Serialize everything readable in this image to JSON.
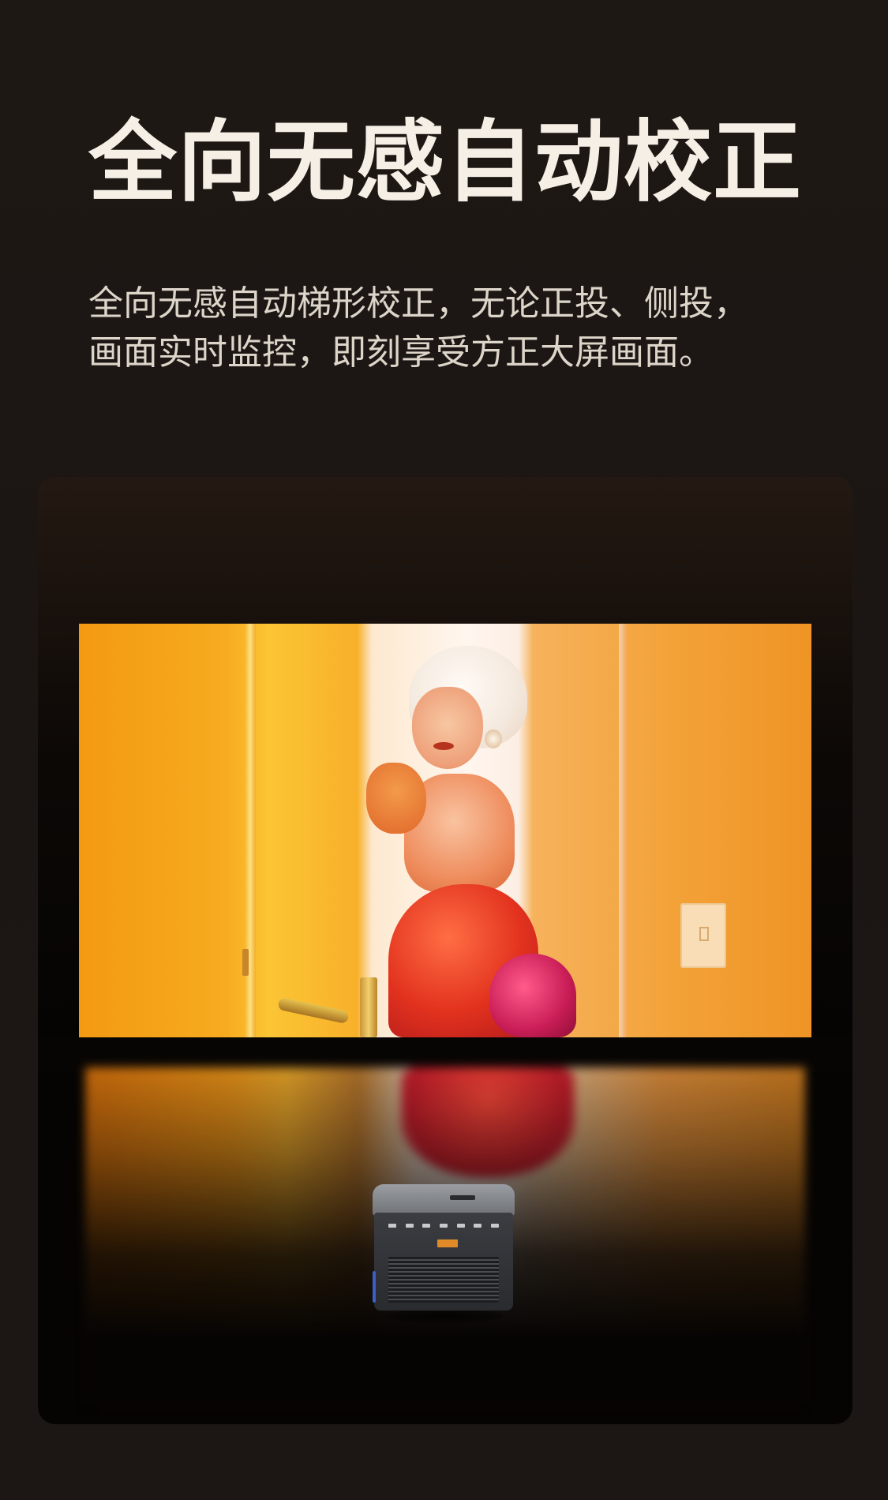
{
  "headline": "全向无感自动校正",
  "description": {
    "line1": "全向无感自动梯形校正，无论正投、侧投，",
    "line2": "画面实时监控，即刻享受方正大屏画面。"
  },
  "colors": {
    "background": "#1b1613",
    "headline": "#f5efe6",
    "description": "#ddd5ca",
    "accent_orange": "#f39a12"
  }
}
